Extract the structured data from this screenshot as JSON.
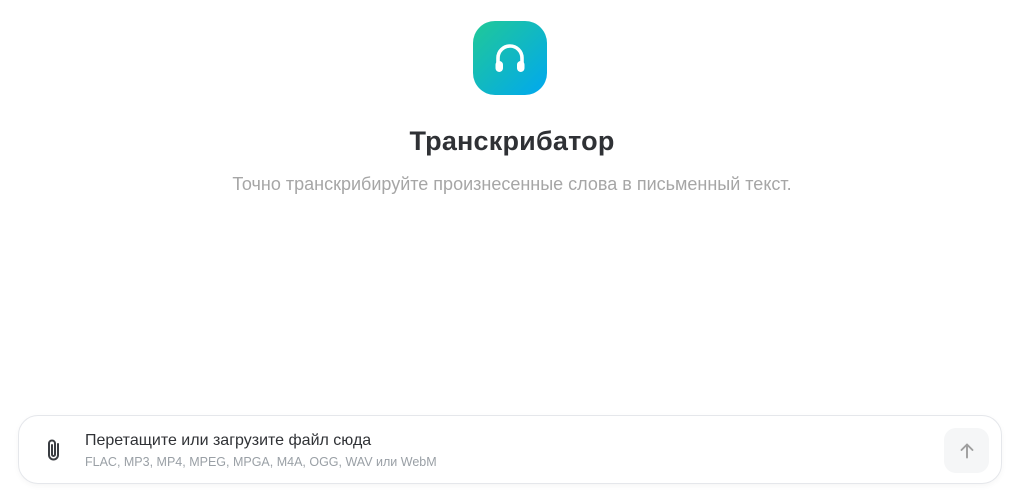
{
  "app": {
    "title": "Транскрибатор",
    "subtitle": "Точно транскрибируйте произнесенные слова в письменный текст.",
    "icon": "headphones-icon",
    "icon_gradient": [
      "#20c997",
      "#00a8f0"
    ]
  },
  "upload": {
    "title": "Перетащите или загрузите файл сюда",
    "formats": "FLAC, MP3, MP4, MPEG, MPGA, M4A, OGG, WAV или WebM",
    "attach_icon": "paperclip-icon",
    "send_icon": "arrow-up-icon"
  },
  "colors": {
    "title": "#2f3135",
    "subtitle": "#a6a6a6",
    "icon_white": "#ffffff",
    "send_arrow": "#9e9e9e"
  }
}
